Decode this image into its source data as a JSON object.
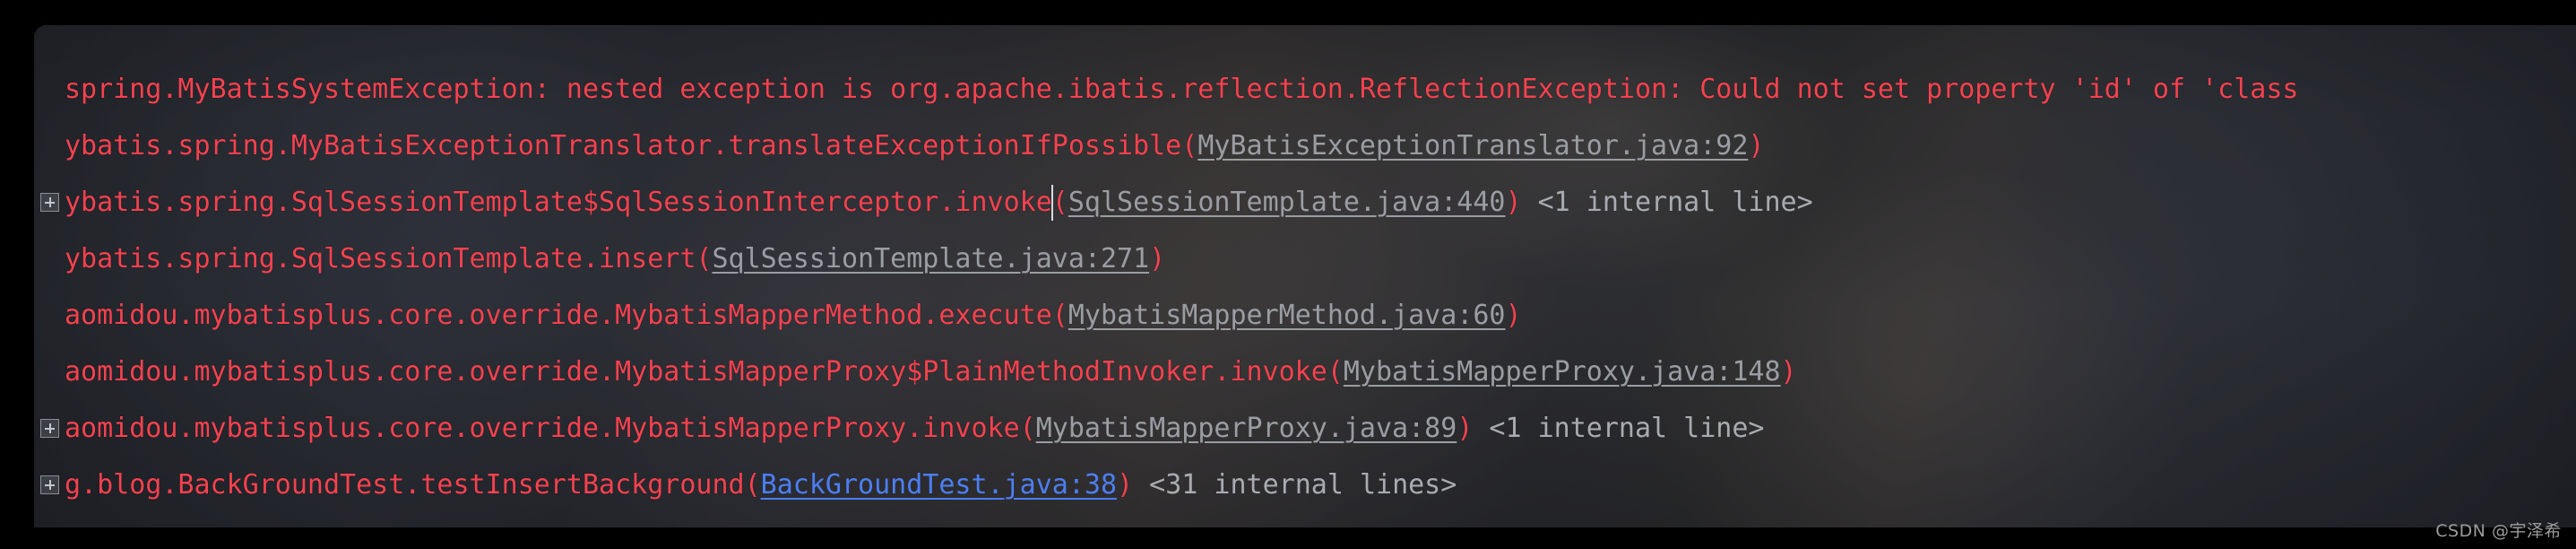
{
  "app": {
    "kind": "ide-run-console",
    "colors": {
      "error_text": "#f5424f",
      "link_dim": "#9a9da3",
      "link_blue": "#4c7ef3",
      "muted_text": "#a8abb1",
      "panel_background": "#2b2d31",
      "frame_background": "#000000",
      "caret": "#d8dade"
    }
  },
  "console": {
    "lines": [
      {
        "id": "line-1",
        "fold": null,
        "segments": [
          {
            "kind": "error",
            "text": "spring.MyBatisSystemException: nested exception is org.apache.ibatis.reflection.ReflectionException: Could not set property 'id' of 'class"
          }
        ]
      },
      {
        "id": "line-2",
        "fold": null,
        "segments": [
          {
            "kind": "error",
            "text": "ybatis.spring.MyBatisExceptionTranslator.translateExceptionIfPossible("
          },
          {
            "kind": "link",
            "text": "MyBatisExceptionTranslator.java:92"
          },
          {
            "kind": "error",
            "text": ")"
          }
        ]
      },
      {
        "id": "line-3",
        "fold": "expand",
        "segments": [
          {
            "kind": "error",
            "text": "ybatis.spring.SqlSessionTemplate$SqlSessionInterceptor.invoke("
          },
          {
            "kind": "link",
            "text": "SqlSessionTemplate.java:440"
          },
          {
            "kind": "error",
            "text": ")"
          },
          {
            "kind": "muted",
            "text": " <1 internal line>"
          }
        ]
      },
      {
        "id": "line-4",
        "fold": null,
        "segments": [
          {
            "kind": "error",
            "text": "ybatis.spring.SqlSessionTemplate.insert("
          },
          {
            "kind": "link",
            "text": "SqlSessionTemplate.java:271"
          },
          {
            "kind": "error",
            "text": ")"
          }
        ]
      },
      {
        "id": "line-5",
        "fold": null,
        "segments": [
          {
            "kind": "error",
            "text": "aomidou.mybatisplus.core.override.MybatisMapperMethod.execute("
          },
          {
            "kind": "link",
            "text": "MybatisMapperMethod.java:60"
          },
          {
            "kind": "error",
            "text": ")"
          }
        ]
      },
      {
        "id": "line-6",
        "fold": null,
        "segments": [
          {
            "kind": "error",
            "text": "aomidou.mybatisplus.core.override.MybatisMapperProxy$PlainMethodInvoker.invoke("
          },
          {
            "kind": "link",
            "text": "MybatisMapperProxy.java:148"
          },
          {
            "kind": "error",
            "text": ")"
          }
        ]
      },
      {
        "id": "line-7",
        "fold": "expand",
        "segments": [
          {
            "kind": "error",
            "text": "aomidou.mybatisplus.core.override.MybatisMapperProxy.invoke("
          },
          {
            "kind": "link",
            "text": "MybatisMapperProxy.java:89"
          },
          {
            "kind": "error",
            "text": ")"
          },
          {
            "kind": "muted",
            "text": " <1 internal line>"
          }
        ]
      },
      {
        "id": "line-8",
        "fold": "expand",
        "segments": [
          {
            "kind": "error",
            "text": "g.blog.BackGroundTest.testInsertBackground("
          },
          {
            "kind": "link-blue",
            "text": "BackGroundTest.java:38"
          },
          {
            "kind": "error",
            "text": ")"
          },
          {
            "kind": "muted",
            "text": " <31 internal lines>"
          }
        ]
      }
    ],
    "fold_marker_icon": "expand-plus-icon"
  },
  "watermark": {
    "text": "CSDN @宇泽希"
  }
}
